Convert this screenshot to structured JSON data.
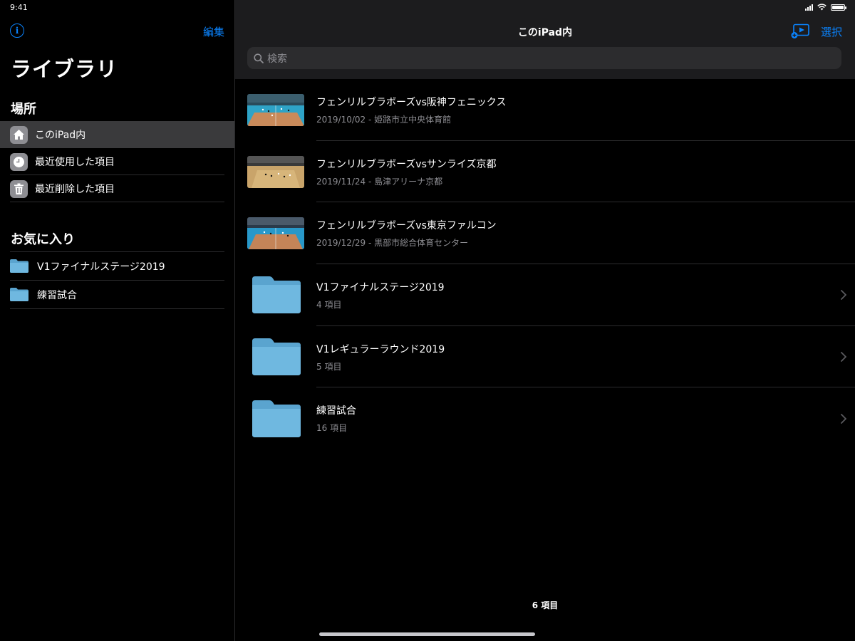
{
  "status": {
    "time": "9:41"
  },
  "sidebar": {
    "edit_label": "編集",
    "title": "ライブラリ",
    "locations_header": "場所",
    "locations": [
      {
        "label": "このiPad内",
        "icon": "house-icon"
      },
      {
        "label": "最近使用した項目",
        "icon": "clock-icon"
      },
      {
        "label": "最近削除した項目",
        "icon": "trash-icon"
      }
    ],
    "favorites_header": "お気に入り",
    "favorites": [
      {
        "label": "V1ファイナルステージ2019"
      },
      {
        "label": "練習試合"
      }
    ]
  },
  "main": {
    "nav_title": "このiPad内",
    "select_label": "選択",
    "search_placeholder": "検索",
    "items": [
      {
        "type": "video",
        "title": "フェンリルブラボーズvs阪神フェニックス",
        "subtitle": "2019/10/02 - 姫路市立中央体育館"
      },
      {
        "type": "video",
        "title": "フェンリルブラボーズvsサンライズ京都",
        "subtitle": "2019/11/24 - 島津アリーナ京都"
      },
      {
        "type": "video",
        "title": "フェンリルブラボーズvs東京ファルコン",
        "subtitle": "2019/12/29 - 黒部市総合体育センター"
      },
      {
        "type": "folder",
        "title": "V1ファイナルステージ2019",
        "subtitle": "4 項目"
      },
      {
        "type": "folder",
        "title": "V1レギュラーラウンド2019",
        "subtitle": "5 項目"
      },
      {
        "type": "folder",
        "title": "練習試合",
        "subtitle": "16 項目"
      }
    ],
    "footer_count": "6 項目"
  },
  "colors": {
    "accent": "#0a84ff",
    "folder": "#6fb8e0"
  }
}
